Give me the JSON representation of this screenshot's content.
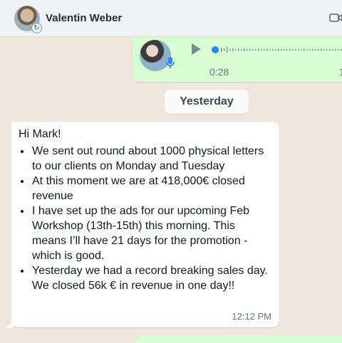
{
  "header": {
    "contact_name": "Valentin Weber"
  },
  "voice_message": {
    "duration": "0:28",
    "cut_off_text": "1"
  },
  "date_separator": "Yesterday",
  "message": {
    "greeting": "Hi Mark!",
    "bullets": [
      "We sent out round about 1000 physical letters to our clients on Monday and Tuesday",
      "At this moment we are at 418,000€ closed revenue",
      "I have set up the ads for our upcoming Feb Workshop (13th-15th) this morning. This means I’ll have 21 days for the promotion - which is good.",
      "Yesterday we had a record breaking sales day. We closed 56k € in revenue in one day!!"
    ],
    "time": "12:12 PM"
  },
  "colors": {
    "chat_background": "#efe7dd",
    "outgoing_bubble": "#d9fdd3",
    "incoming_bubble": "#ffffff",
    "accent_blue": "#1d8cf8"
  },
  "icons": [
    "status-ring-icon",
    "video-call-icon",
    "play-icon",
    "microphone-icon"
  ]
}
